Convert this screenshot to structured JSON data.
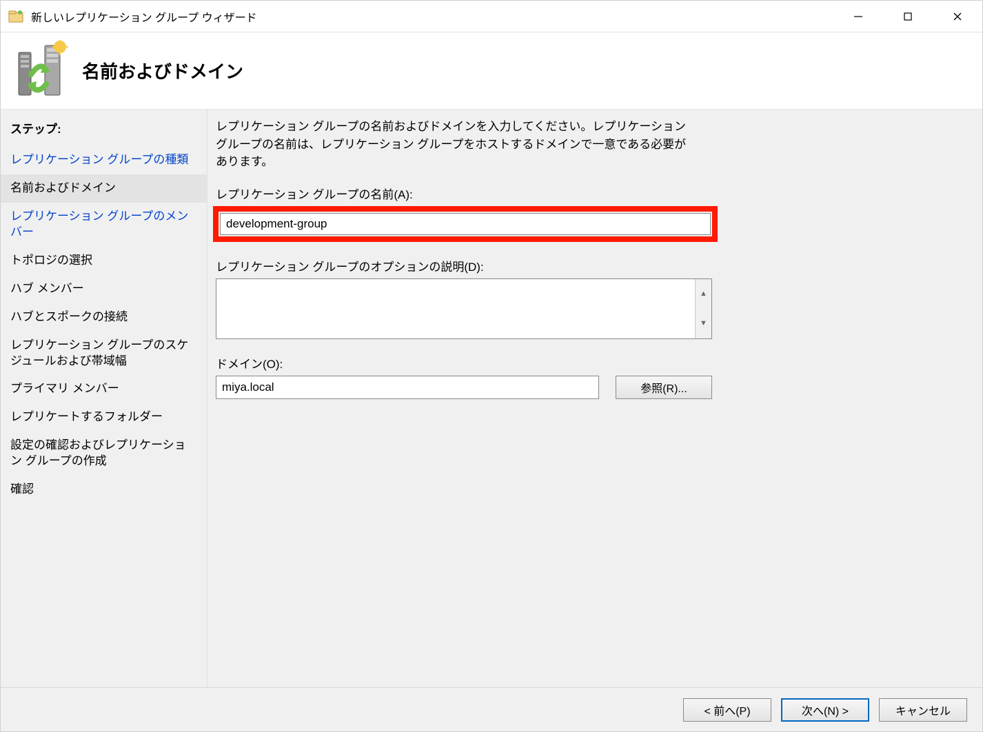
{
  "window": {
    "title": "新しいレプリケーション グループ ウィザード"
  },
  "header": {
    "title": "名前およびドメイン"
  },
  "sidebar": {
    "steps_label": "ステップ:",
    "items": [
      {
        "label": "レプリケーション グループの種類",
        "link": true
      },
      {
        "label": "名前およびドメイン",
        "active": true
      },
      {
        "label": "レプリケーション グループのメンバー",
        "link": true
      },
      {
        "label": "トポロジの選択"
      },
      {
        "label": "ハブ メンバー"
      },
      {
        "label": "ハブとスポークの接続"
      },
      {
        "label": "レプリケーション グループのスケジュールおよび帯域幅"
      },
      {
        "label": "プライマリ メンバー"
      },
      {
        "label": "レプリケートするフォルダー"
      },
      {
        "label": "設定の確認およびレプリケーション グループの作成"
      },
      {
        "label": "確認"
      }
    ]
  },
  "main": {
    "instruction": "レプリケーション グループの名前およびドメインを入力してください。レプリケーション グループの名前は、レプリケーション グループをホストするドメインで一意である必要があります。",
    "name_label": "レプリケーション グループの名前(A):",
    "name_value": "development-group",
    "desc_label": "レプリケーション グループのオプションの説明(D):",
    "desc_value": "",
    "domain_label": "ドメイン(O):",
    "domain_value": "miya.local",
    "browse_label": "参照(R)..."
  },
  "footer": {
    "back": "< 前へ(P)",
    "next": "次へ(N) >",
    "cancel": "キャンセル"
  }
}
